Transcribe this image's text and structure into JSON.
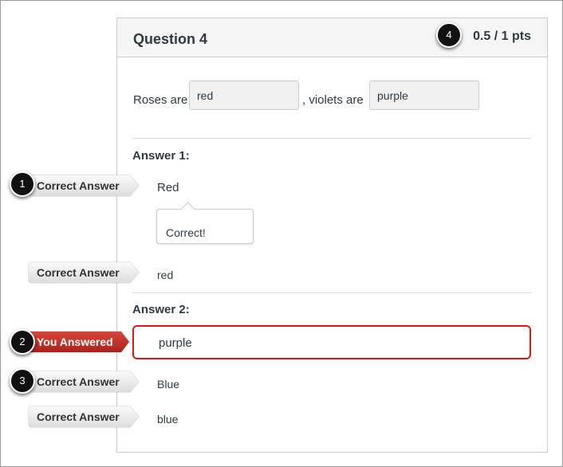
{
  "question": {
    "title": "Question 4",
    "points": "0.5 / 1 pts",
    "text": {
      "part1": "Roses are",
      "blank1": "red",
      "part2": ", violets are",
      "blank2": "purple"
    }
  },
  "answer1": {
    "heading": "Answer 1:",
    "correct_label": "Correct Answer",
    "answer": "Red",
    "tooltip": "Correct!",
    "alt_label": "Correct Answer",
    "alt_answer": "red"
  },
  "answer2": {
    "heading": "Answer 2:",
    "you_label": "You Answered",
    "your_answer": "purple",
    "correct_label": "Correct Answer",
    "answer": "Blue",
    "alt_label": "Correct Answer",
    "alt_answer": "blue"
  },
  "badges": [
    "1",
    "2",
    "3",
    "4"
  ],
  "colors": {
    "wrong": "#e0161d",
    "tag_red": "#c0342b"
  }
}
